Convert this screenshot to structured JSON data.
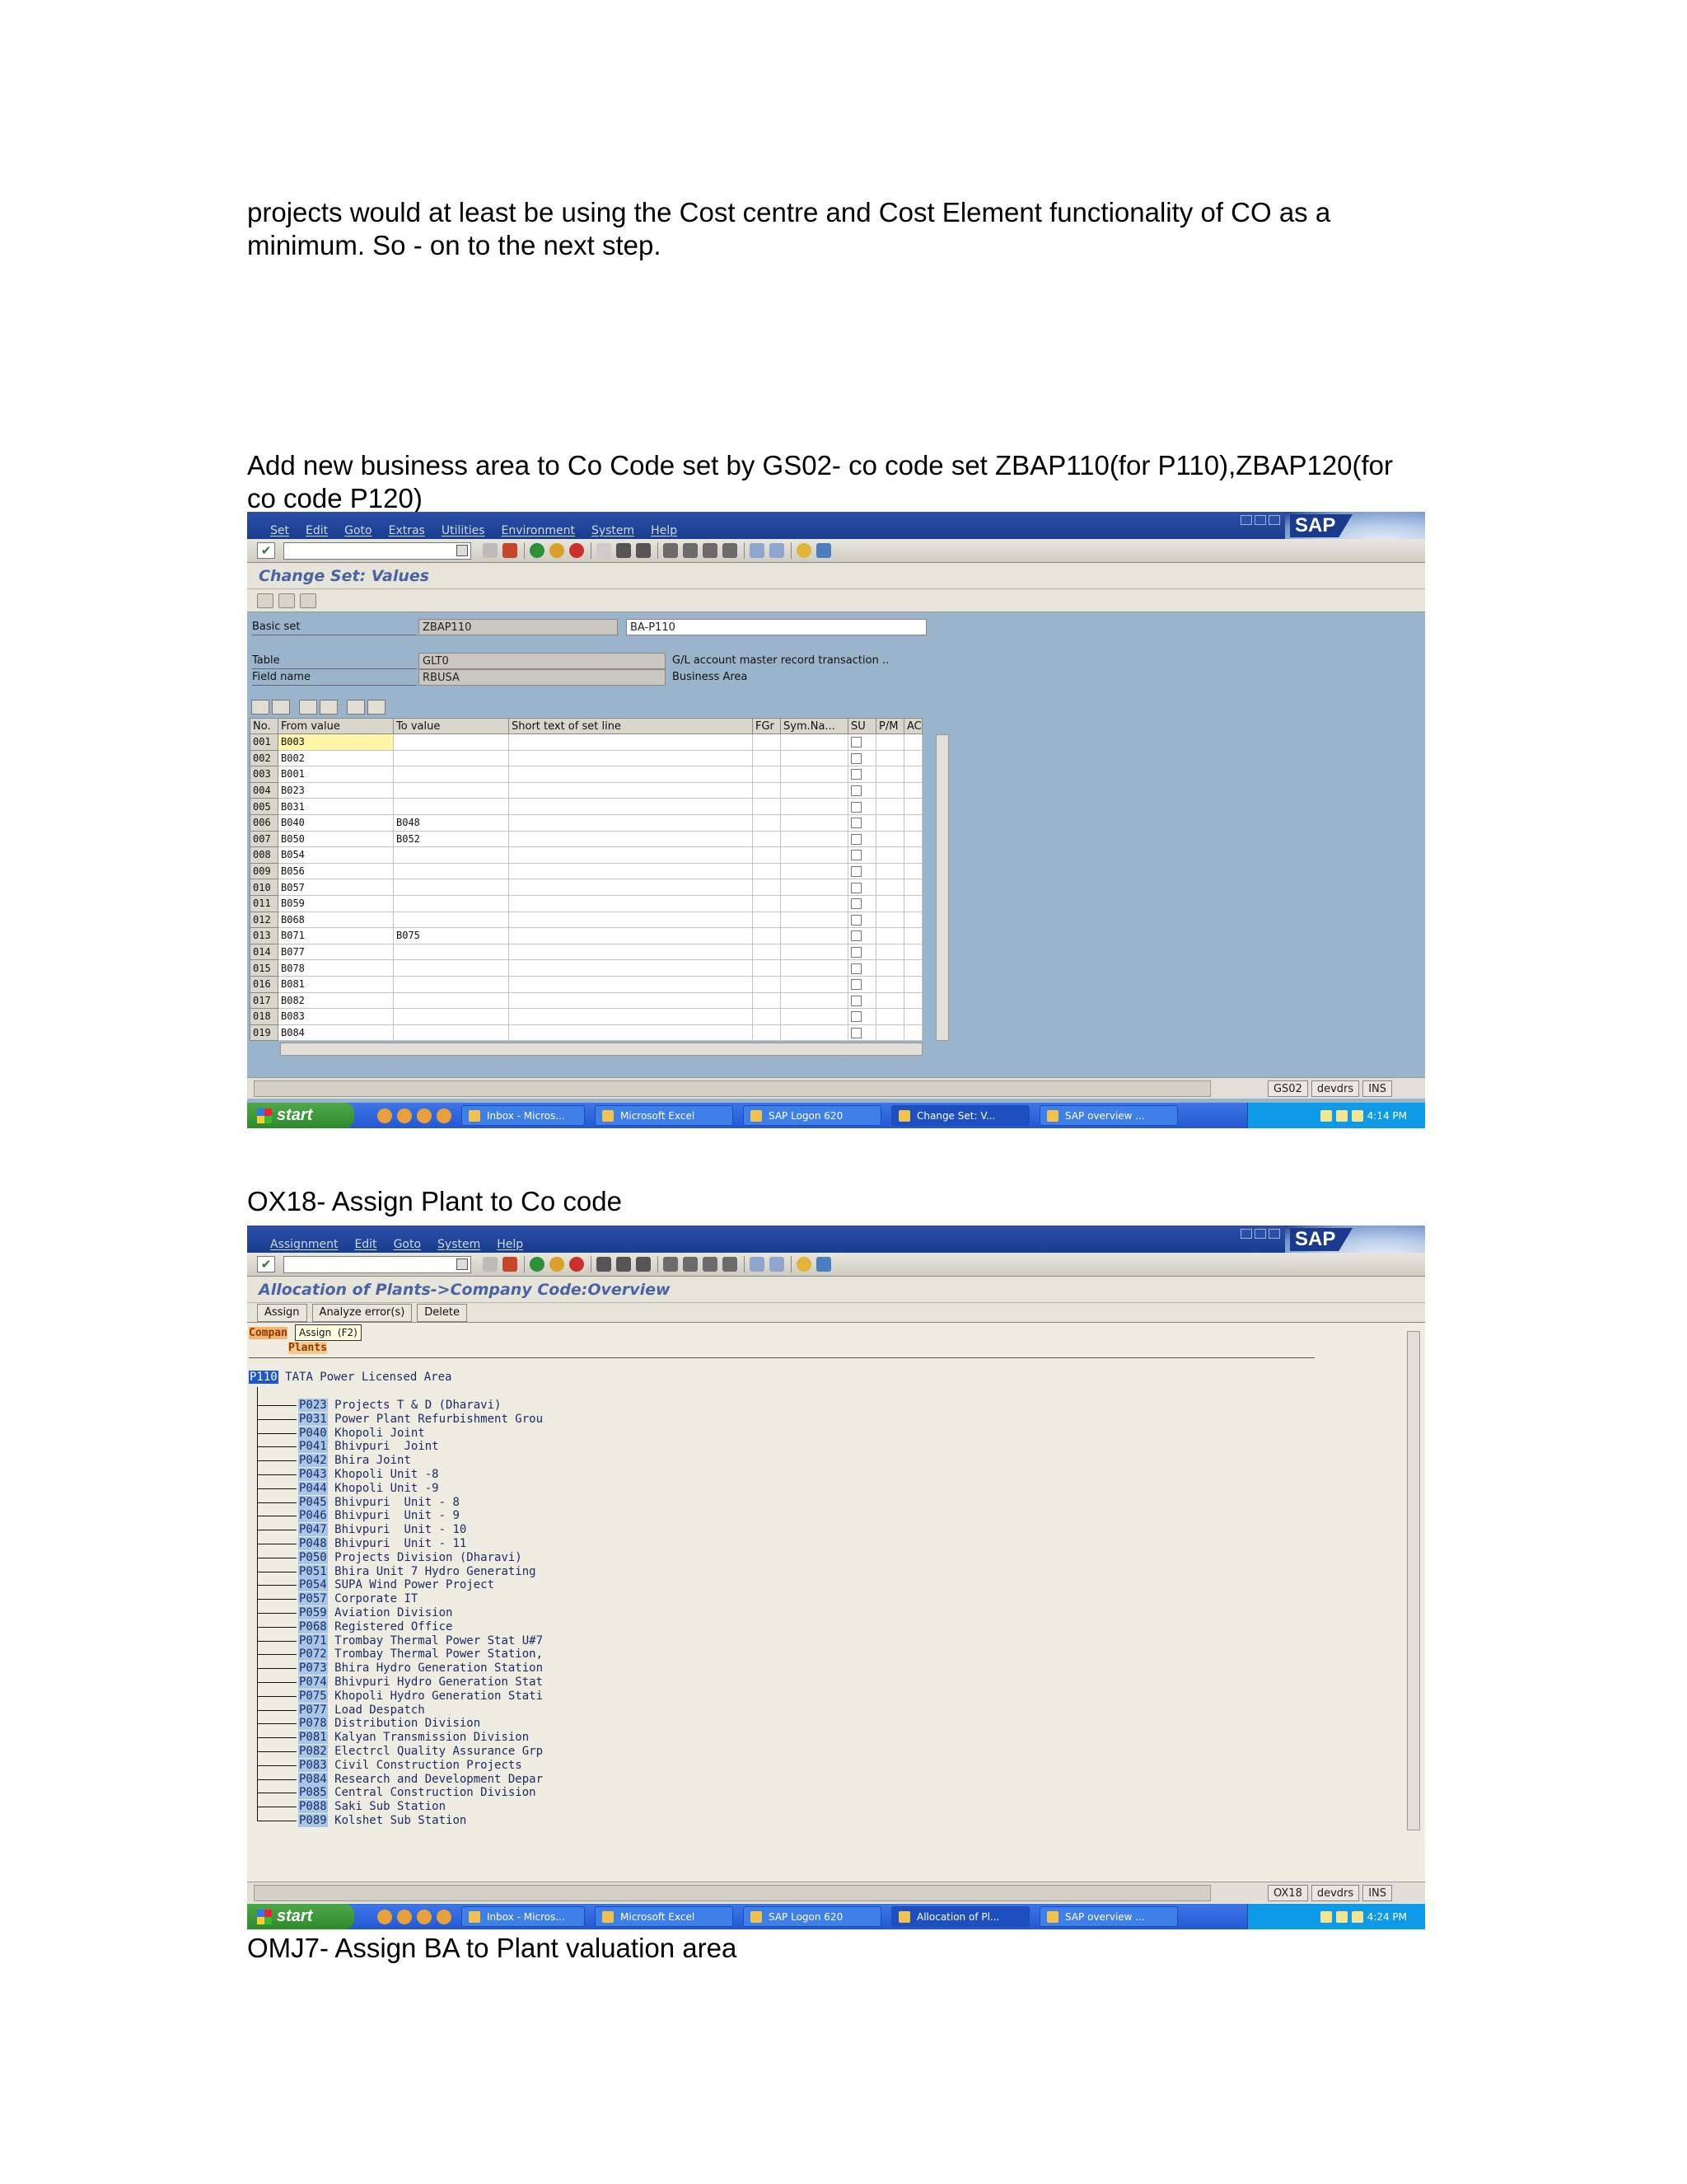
{
  "intro_text": "projects would at least be using the Cost centre and Cost Element functionality of CO as a\nminimum.  So - on to the next step.",
  "caption1": "Add new business area to Co Code set by GS02- co code set ZBAP110(for P110),ZBAP120(for\nco code P120)",
  "caption2": "OX18- Assign Plant to Co code",
  "caption3": "OMJ7- Assign BA to Plant valuation area",
  "screen1": {
    "menu": [
      "Set",
      "Edit",
      "Goto",
      "Extras",
      "Utilities",
      "Environment",
      "System",
      "Help"
    ],
    "sap_logo": "SAP",
    "title": "Change Set: Values",
    "basic_set_label": "Basic set",
    "basic_set_value": "ZBAP110",
    "basic_set_desc": "BA-P110",
    "table_label": "Table",
    "table_value": "GLT0",
    "table_desc": "G/L account master record transaction ..",
    "field_label": "Field name",
    "field_value": "RBUSA",
    "field_desc": "Business Area",
    "columns": [
      "No.",
      "From value",
      "To value",
      "Short text of set line",
      "FGr",
      "Sym.Na...",
      "SU",
      "P/M",
      "AC"
    ],
    "rows": [
      {
        "no": "001",
        "from": "B003",
        "to": ""
      },
      {
        "no": "002",
        "from": "B002",
        "to": ""
      },
      {
        "no": "003",
        "from": "B001",
        "to": ""
      },
      {
        "no": "004",
        "from": "B023",
        "to": ""
      },
      {
        "no": "005",
        "from": "B031",
        "to": ""
      },
      {
        "no": "006",
        "from": "B040",
        "to": "B048"
      },
      {
        "no": "007",
        "from": "B050",
        "to": "B052"
      },
      {
        "no": "008",
        "from": "B054",
        "to": ""
      },
      {
        "no": "009",
        "from": "B056",
        "to": ""
      },
      {
        "no": "010",
        "from": "B057",
        "to": ""
      },
      {
        "no": "011",
        "from": "B059",
        "to": ""
      },
      {
        "no": "012",
        "from": "B068",
        "to": ""
      },
      {
        "no": "013",
        "from": "B071",
        "to": "B075"
      },
      {
        "no": "014",
        "from": "B077",
        "to": ""
      },
      {
        "no": "015",
        "from": "B078",
        "to": ""
      },
      {
        "no": "016",
        "from": "B081",
        "to": ""
      },
      {
        "no": "017",
        "from": "B082",
        "to": ""
      },
      {
        "no": "018",
        "from": "B083",
        "to": ""
      },
      {
        "no": "019",
        "from": "B084",
        "to": ""
      }
    ],
    "status_tcode": "GS02",
    "status_server": "devdrs",
    "status_mode": "INS",
    "taskbar": {
      "start": "start",
      "items": [
        "Inbox - Micros...",
        "Microsoft Excel",
        "SAP Logon 620",
        "Change Set: V...",
        "SAP overview ..."
      ],
      "clock": "4:14 PM"
    }
  },
  "screen2": {
    "menu": [
      "Assignment",
      "Edit",
      "Goto",
      "System",
      "Help"
    ],
    "sap_logo": "SAP",
    "title": "Allocation of Plants->Company Code:Overview",
    "buttons": [
      "Assign",
      "Analyze error(s)",
      "Delete"
    ],
    "tooltip": "Assign  (F2)",
    "col_head1": "Compan",
    "col_head2": "Plants",
    "company_code": "P110",
    "company_name": "TATA Power Licensed Area",
    "plants": [
      {
        "code": "P023",
        "name": "Projects T & D (Dharavi)"
      },
      {
        "code": "P031",
        "name": "Power Plant Refurbishment Grou"
      },
      {
        "code": "P040",
        "name": "Khopoli Joint"
      },
      {
        "code": "P041",
        "name": "Bhivpuri  Joint"
      },
      {
        "code": "P042",
        "name": "Bhira Joint"
      },
      {
        "code": "P043",
        "name": "Khopoli Unit -8"
      },
      {
        "code": "P044",
        "name": "Khopoli Unit -9"
      },
      {
        "code": "P045",
        "name": "Bhivpuri  Unit - 8"
      },
      {
        "code": "P046",
        "name": "Bhivpuri  Unit - 9"
      },
      {
        "code": "P047",
        "name": "Bhivpuri  Unit - 10"
      },
      {
        "code": "P048",
        "name": "Bhivpuri  Unit - 11"
      },
      {
        "code": "P050",
        "name": "Projects Division (Dharavi)"
      },
      {
        "code": "P051",
        "name": "Bhira Unit 7 Hydro Generating"
      },
      {
        "code": "P054",
        "name": "SUPA Wind Power Project"
      },
      {
        "code": "P057",
        "name": "Corporate IT"
      },
      {
        "code": "P059",
        "name": "Aviation Division"
      },
      {
        "code": "P068",
        "name": "Registered Office"
      },
      {
        "code": "P071",
        "name": "Trombay Thermal Power Stat U#7"
      },
      {
        "code": "P072",
        "name": "Trombay Thermal Power Station,"
      },
      {
        "code": "P073",
        "name": "Bhira Hydro Generation Station"
      },
      {
        "code": "P074",
        "name": "Bhivpuri Hydro Generation Stat"
      },
      {
        "code": "P075",
        "name": "Khopoli Hydro Generation Stati"
      },
      {
        "code": "P077",
        "name": "Load Despatch"
      },
      {
        "code": "P078",
        "name": "Distribution Division"
      },
      {
        "code": "P081",
        "name": "Kalyan Transmission Division"
      },
      {
        "code": "P082",
        "name": "Electrcl Quality Assurance Grp"
      },
      {
        "code": "P083",
        "name": "Civil Construction Projects"
      },
      {
        "code": "P084",
        "name": "Research and Development Depar"
      },
      {
        "code": "P085",
        "name": "Central Construction Division"
      },
      {
        "code": "P088",
        "name": "Saki Sub Station"
      },
      {
        "code": "P089",
        "name": "Kolshet Sub Station"
      }
    ],
    "status_tcode": "OX18",
    "status_server": "devdrs",
    "status_mode": "INS",
    "taskbar": {
      "start": "start",
      "items": [
        "Inbox - Micros...",
        "Microsoft Excel",
        "SAP Logon 620",
        "Allocation of Pl...",
        "SAP overview ..."
      ],
      "clock": "4:24 PM"
    }
  }
}
